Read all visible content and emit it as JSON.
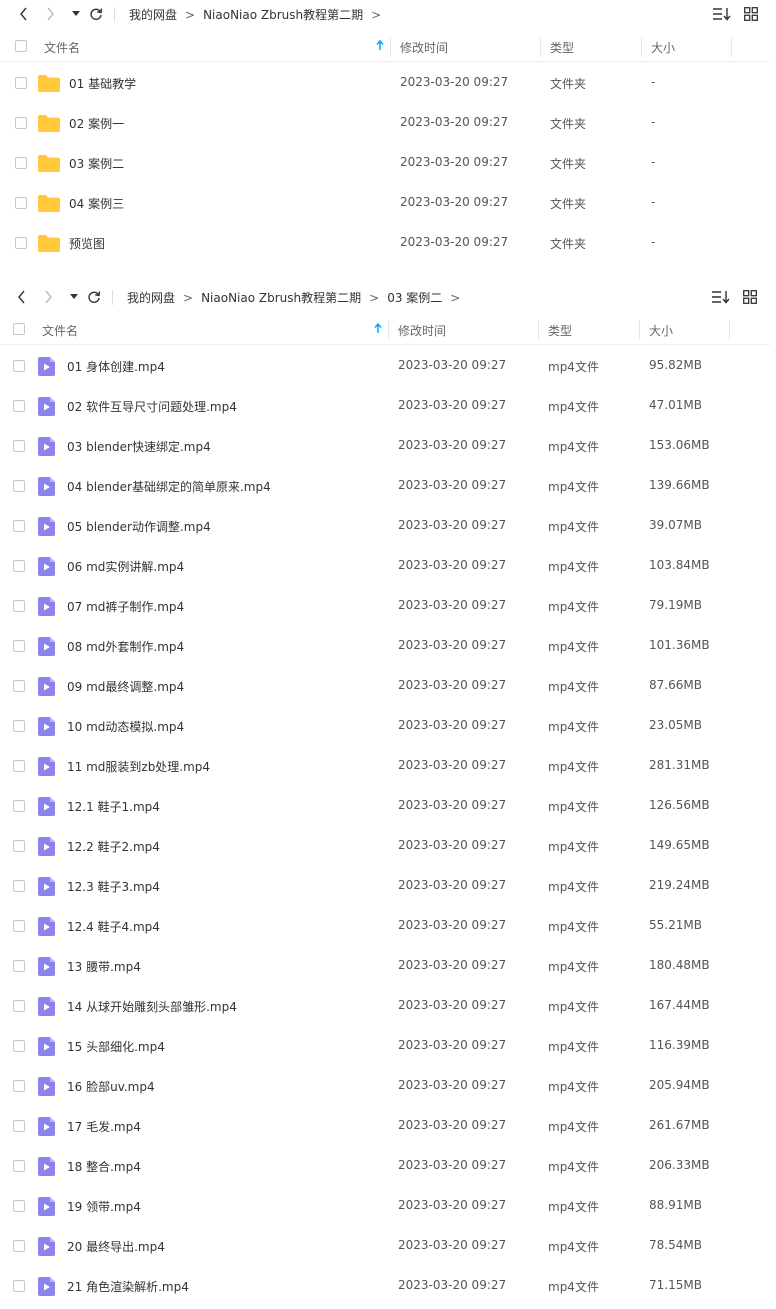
{
  "colors": {
    "folder": "#FFC83D",
    "video": "#8C84EC",
    "sort_arrow": "#06A7FF"
  },
  "panel1": {
    "breadcrumb": [
      "我的网盘",
      "NiaoNiao Zbrush教程第二期"
    ],
    "sep": ">",
    "header": {
      "name": "文件名",
      "modified": "修改时间",
      "type": "类型",
      "size": "大小"
    },
    "rows": [
      {
        "name": "01 基础教学",
        "modified": "2023-03-20 09:27",
        "type": "文件夹",
        "size": "-"
      },
      {
        "name": "02 案例一",
        "modified": "2023-03-20 09:27",
        "type": "文件夹",
        "size": "-"
      },
      {
        "name": "03 案例二",
        "modified": "2023-03-20 09:27",
        "type": "文件夹",
        "size": "-"
      },
      {
        "name": "04 案例三",
        "modified": "2023-03-20 09:27",
        "type": "文件夹",
        "size": "-"
      },
      {
        "name": "预览图",
        "modified": "2023-03-20 09:27",
        "type": "文件夹",
        "size": "-"
      }
    ]
  },
  "panel2": {
    "breadcrumb": [
      "我的网盘",
      "NiaoNiao Zbrush教程第二期",
      "03 案例二"
    ],
    "sep": ">",
    "header": {
      "name": "文件名",
      "modified": "修改时间",
      "type": "类型",
      "size": "大小"
    },
    "rows": [
      {
        "name": "01 身体创建.mp4",
        "modified": "2023-03-20 09:27",
        "type": "mp4文件",
        "size": "95.82MB"
      },
      {
        "name": "02 软件互导尺寸问题处理.mp4",
        "modified": "2023-03-20 09:27",
        "type": "mp4文件",
        "size": "47.01MB"
      },
      {
        "name": "03 blender快速绑定.mp4",
        "modified": "2023-03-20 09:27",
        "type": "mp4文件",
        "size": "153.06MB"
      },
      {
        "name": "04 blender基础绑定的简单原来.mp4",
        "modified": "2023-03-20 09:27",
        "type": "mp4文件",
        "size": "139.66MB"
      },
      {
        "name": "05 blender动作调整.mp4",
        "modified": "2023-03-20 09:27",
        "type": "mp4文件",
        "size": "39.07MB"
      },
      {
        "name": "06 md实例讲解.mp4",
        "modified": "2023-03-20 09:27",
        "type": "mp4文件",
        "size": "103.84MB"
      },
      {
        "name": "07 md裤子制作.mp4",
        "modified": "2023-03-20 09:27",
        "type": "mp4文件",
        "size": "79.19MB"
      },
      {
        "name": "08 md外套制作.mp4",
        "modified": "2023-03-20 09:27",
        "type": "mp4文件",
        "size": "101.36MB"
      },
      {
        "name": "09 md最终调整.mp4",
        "modified": "2023-03-20 09:27",
        "type": "mp4文件",
        "size": "87.66MB"
      },
      {
        "name": "10 md动态模拟.mp4",
        "modified": "2023-03-20 09:27",
        "type": "mp4文件",
        "size": "23.05MB"
      },
      {
        "name": "11 md服装到zb处理.mp4",
        "modified": "2023-03-20 09:27",
        "type": "mp4文件",
        "size": "281.31MB"
      },
      {
        "name": "12.1 鞋子1.mp4",
        "modified": "2023-03-20 09:27",
        "type": "mp4文件",
        "size": "126.56MB"
      },
      {
        "name": "12.2 鞋子2.mp4",
        "modified": "2023-03-20 09:27",
        "type": "mp4文件",
        "size": "149.65MB"
      },
      {
        "name": "12.3 鞋子3.mp4",
        "modified": "2023-03-20 09:27",
        "type": "mp4文件",
        "size": "219.24MB"
      },
      {
        "name": "12.4 鞋子4.mp4",
        "modified": "2023-03-20 09:27",
        "type": "mp4文件",
        "size": "55.21MB"
      },
      {
        "name": "13 腰带.mp4",
        "modified": "2023-03-20 09:27",
        "type": "mp4文件",
        "size": "180.48MB"
      },
      {
        "name": "14 从球开始雕刻头部雏形.mp4",
        "modified": "2023-03-20 09:27",
        "type": "mp4文件",
        "size": "167.44MB"
      },
      {
        "name": "15 头部细化.mp4",
        "modified": "2023-03-20 09:27",
        "type": "mp4文件",
        "size": "116.39MB"
      },
      {
        "name": "16 脸部uv.mp4",
        "modified": "2023-03-20 09:27",
        "type": "mp4文件",
        "size": "205.94MB"
      },
      {
        "name": "17 毛发.mp4",
        "modified": "2023-03-20 09:27",
        "type": "mp4文件",
        "size": "261.67MB"
      },
      {
        "name": "18 整合.mp4",
        "modified": "2023-03-20 09:27",
        "type": "mp4文件",
        "size": "206.33MB"
      },
      {
        "name": "19 领带.mp4",
        "modified": "2023-03-20 09:27",
        "type": "mp4文件",
        "size": "88.91MB"
      },
      {
        "name": "20 最终导出.mp4",
        "modified": "2023-03-20 09:27",
        "type": "mp4文件",
        "size": "78.54MB"
      },
      {
        "name": "21 角色渲染解析.mp4",
        "modified": "2023-03-20 09:27",
        "type": "mp4文件",
        "size": "71.15MB"
      }
    ]
  }
}
